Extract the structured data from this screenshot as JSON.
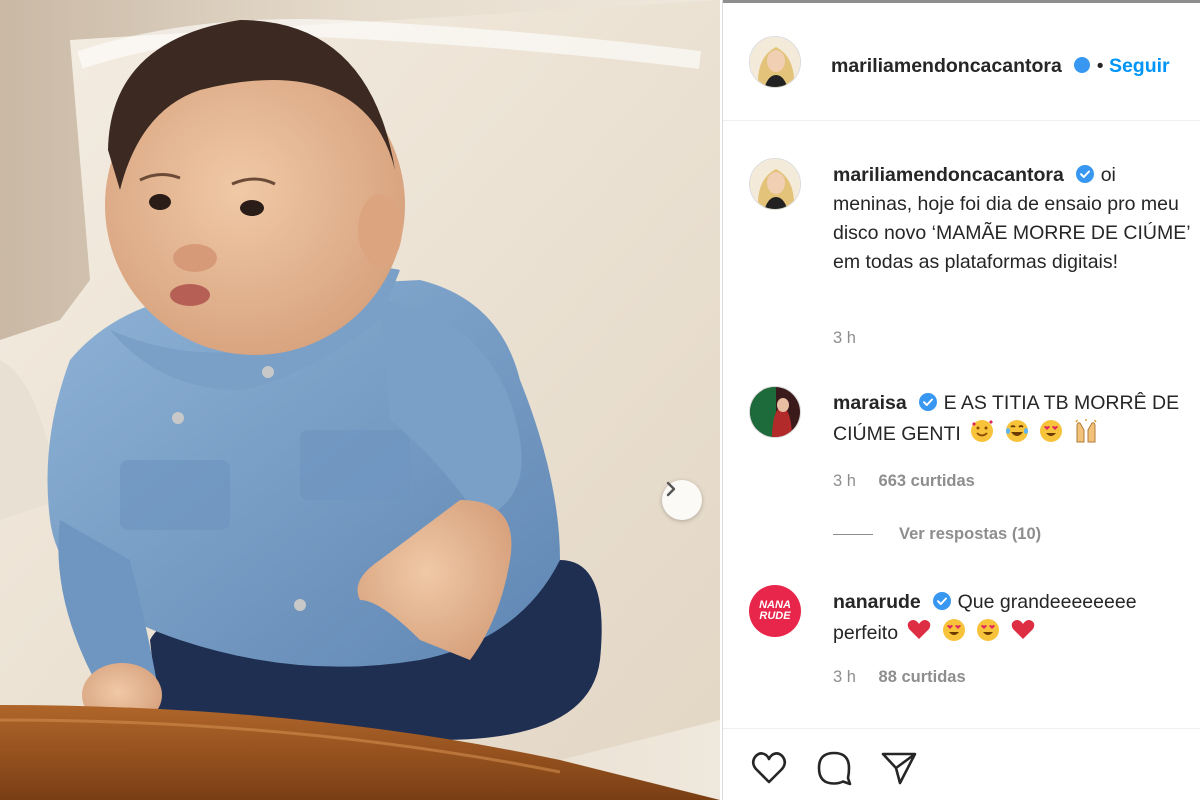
{
  "post": {
    "author": "mariliamendoncacantora",
    "follow_label": "Seguir",
    "separator": "•",
    "caption": {
      "username": "mariliamendoncacantora",
      "text": "oi meninas, hoje foi dia de ensaio pro meu disco novo ‘MAMÃE MORRE DE CIÚME’ em todas as plataformas digitais!",
      "time": "3 h"
    }
  },
  "comments": [
    {
      "username": "maraisa",
      "text": "E AS TITIA TB MORRÊ DE CIÚME GENTI",
      "emojis": [
        "smiling-face-with-hearts-emoji",
        "joy-emoji",
        "heart-eyes-emoji",
        "raising-hands-emoji"
      ],
      "time": "3 h",
      "likes": "663 curtidas",
      "replies_label": "Ver respostas (10)"
    },
    {
      "username": "nanarude",
      "avatar_text": "NANA RUDE",
      "text": "Que grandeeeeeeee perfeito",
      "emojis": [
        "red-heart-emoji",
        "heart-eyes-emoji",
        "heart-eyes-emoji",
        "red-heart-emoji"
      ],
      "time": "3 h",
      "likes": "88 curtidas"
    }
  ],
  "icons": {
    "like": "heart-outline-icon",
    "comment": "comment-bubble-icon",
    "share": "paper-plane-icon",
    "next": "chevron-right-icon",
    "verified": "verified-badge-icon"
  },
  "colors": {
    "accent": "#0095f6",
    "verified": "#3897f0",
    "text": "#262626",
    "muted": "#8e8e8e",
    "nanarude_brand": "#e8264b"
  }
}
